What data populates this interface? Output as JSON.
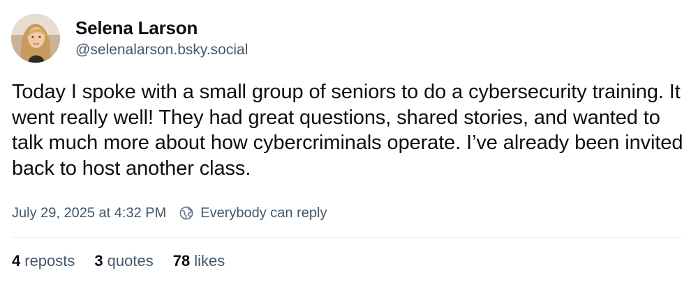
{
  "author": {
    "display_name": "Selena Larson",
    "handle": "@selenalarson.bsky.social",
    "avatar_icon": "profile-photo"
  },
  "post": {
    "text": "Today I spoke with a small group of seniors to do a cybersecurity training. It went really well! They had great questions, shared stories, and wanted to talk much more about how cybercriminals operate. I’ve already been invited back to host another class.",
    "timestamp": "July 29, 2025 at 4:32 PM",
    "reply_setting": "Everybody can reply",
    "reply_icon": "globe-icon"
  },
  "stats": {
    "reposts": {
      "count": "4",
      "label": "reposts"
    },
    "quotes": {
      "count": "3",
      "label": "quotes"
    },
    "likes": {
      "count": "78",
      "label": "likes"
    }
  },
  "colors": {
    "primary_text": "#0b0f14",
    "secondary_text": "#42576c",
    "divider": "#e3e8ee",
    "background": "#ffffff"
  }
}
